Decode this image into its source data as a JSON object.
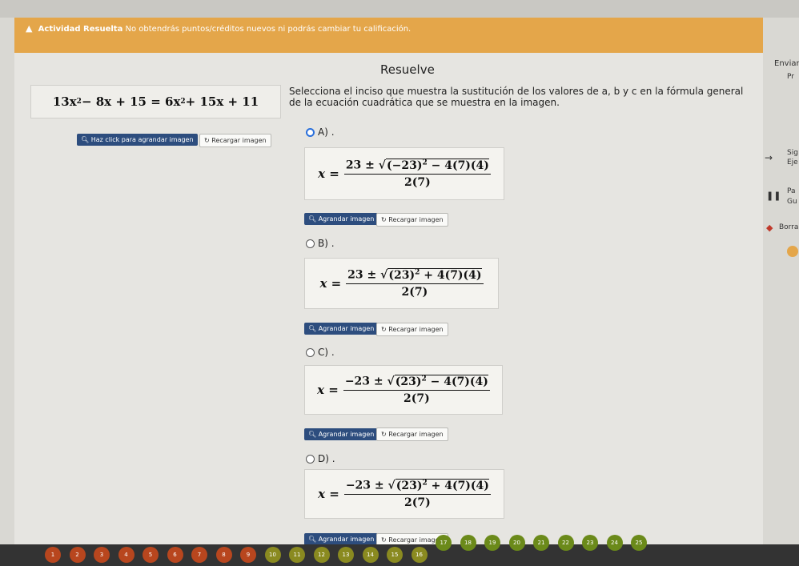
{
  "banner": {
    "bold": "Actividad Resuelta",
    "text": "No obtendrás puntos/créditos nuevos ni podrás cambiar tu calificación."
  },
  "title": "Resuelve",
  "equation_parts": [
    "13x",
    "2",
    " − 8x + 15 = 6x",
    "2",
    " + 15x + 11"
  ],
  "instructions": "Selecciona el inciso que muestra la sustitución de los valores de a, b y c en la fórmula general de la ecuación cuadrática que se muestra en la imagen.",
  "left_buttons": {
    "enlarge": "Haz click para agrandar imagen",
    "reload": "Recargar imagen"
  },
  "option_buttons": {
    "enlarge": "Agrandar imagen",
    "reload": "Recargar imagen"
  },
  "options": [
    {
      "label": "A) .",
      "num_pre": "23 ± ",
      "rad_a": "(−23)",
      "rad_b": " − 4(7)(4)",
      "den": "2(7)"
    },
    {
      "label": "B) .",
      "num_pre": "23 ± ",
      "rad_a": "(23)",
      "rad_b": " + 4(7)(4)",
      "den": "2(7)"
    },
    {
      "label": "C) .",
      "num_pre": "−23 ± ",
      "rad_a": "(23)",
      "rad_b": " − 4(7)(4)",
      "den": "2(7)"
    },
    {
      "label": "D) .",
      "num_pre": "−23 ± ",
      "rad_a": "(23)",
      "rad_b": " + 4(7)(4)",
      "den": "2(7)"
    }
  ],
  "x_eq": "x =",
  "sup2": "2",
  "right_panel": {
    "send": "Enviar",
    "p": "Pr",
    "sig": "Sig",
    "eje": "Eje",
    "pa": "Pa",
    "gu": "Gu",
    "borr": "Borra"
  },
  "nav_numbers": [
    "1",
    "2",
    "3",
    "4",
    "5",
    "6",
    "7",
    "8",
    "9",
    "10",
    "11",
    "12",
    "13",
    "14",
    "15",
    "16",
    "17",
    "18",
    "19",
    "20",
    "21",
    "22",
    "23",
    "24",
    "25"
  ]
}
